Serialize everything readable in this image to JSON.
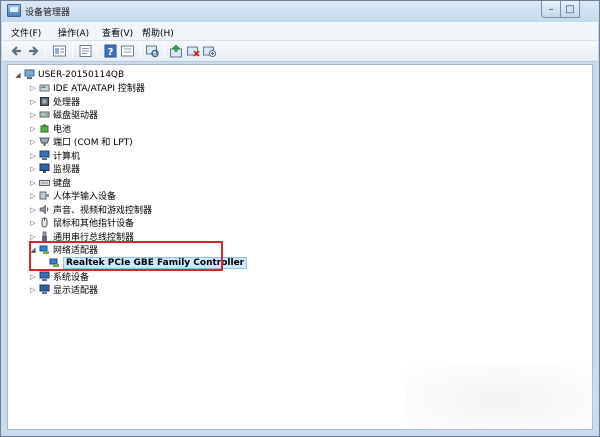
{
  "window": {
    "title": "设备管理器"
  },
  "menu": [
    "文件(F)",
    "操作(A)",
    "查看(V)",
    "帮助(H)"
  ],
  "toolbar": [
    "back-icon",
    "forward-icon",
    "view-icon",
    "properties-icon",
    "help-icon",
    "details-icon",
    "scan-icon",
    "update-driver-icon",
    "uninstall-icon",
    "disable-icon"
  ],
  "tree": {
    "root": "USER-20150114QB",
    "items": [
      {
        "label": "IDE ATA/ATAPI 控制器",
        "icon": "ide-controller-icon"
      },
      {
        "label": "处理器",
        "icon": "processor-icon"
      },
      {
        "label": "磁盘驱动器",
        "icon": "disk-drive-icon"
      },
      {
        "label": "电池",
        "icon": "battery-icon"
      },
      {
        "label": "端口 (COM 和 LPT)",
        "icon": "port-icon"
      },
      {
        "label": "计算机",
        "icon": "computer-icon"
      },
      {
        "label": "监视器",
        "icon": "monitor-icon"
      },
      {
        "label": "键盘",
        "icon": "keyboard-icon"
      },
      {
        "label": "人体学输入设备",
        "icon": "hid-icon"
      },
      {
        "label": "声音、视频和游戏控制器",
        "icon": "sound-icon"
      },
      {
        "label": "鼠标和其他指针设备",
        "icon": "mouse-icon"
      },
      {
        "label": "通用串行总线控制器",
        "icon": "usb-icon"
      },
      {
        "label": "网络适配器",
        "icon": "network-adapter-icon"
      },
      {
        "label": "Realtek PCIe GBE Family Controller",
        "icon": "network-card-icon"
      },
      {
        "label": "系统设备",
        "icon": "system-device-icon"
      },
      {
        "label": "显示适配器",
        "icon": "display-adapter-icon"
      }
    ]
  },
  "colors": {
    "highlight": "#d9262e",
    "selection": "#cde8ff",
    "chrome": "#c9dcef"
  }
}
